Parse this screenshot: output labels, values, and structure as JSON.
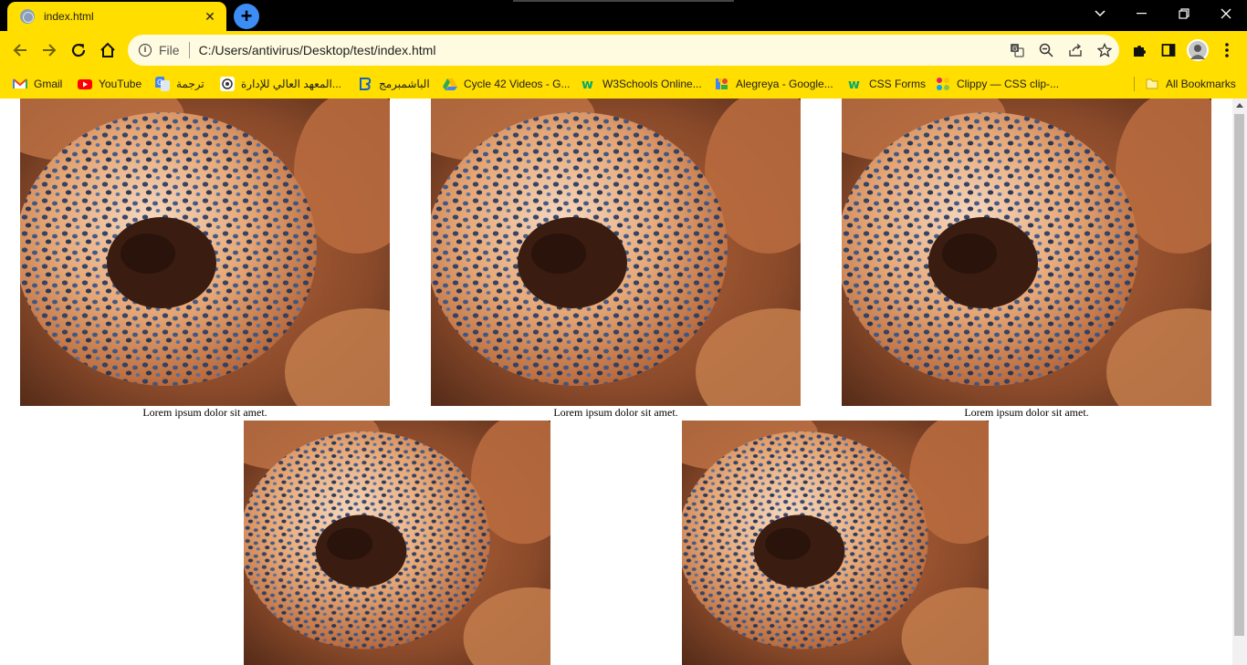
{
  "browser": {
    "tab_title": "index.html",
    "tab_close": "✕",
    "new_tab": "+",
    "window_controls": {
      "minimize": "—",
      "restore": "❐",
      "close": "✕"
    },
    "address": {
      "scheme": "File",
      "url": "C:/Users/antivirus/Desktop/test/index.html"
    },
    "accent_color": "#ffde00"
  },
  "bookmarks": [
    {
      "label": "Gmail",
      "icon": "gmail-icon"
    },
    {
      "label": "YouTube",
      "icon": "youtube-icon"
    },
    {
      "label": "ترجمة",
      "icon": "translate-icon"
    },
    {
      "label": "المعهد العالي للإدارة...",
      "icon": "institute-icon"
    },
    {
      "label": "الباشمبرمج",
      "icon": "bashmohandes-icon"
    },
    {
      "label": "Cycle 42 Videos - G...",
      "icon": "drive-icon"
    },
    {
      "label": "W3Schools Online...",
      "icon": "w3schools-icon"
    },
    {
      "label": "Alegreya - Google...",
      "icon": "google-fonts-icon"
    },
    {
      "label": "CSS Forms",
      "icon": "w3schools-icon"
    },
    {
      "label": "Clippy — CSS clip-...",
      "icon": "clippy-icon"
    }
  ],
  "all_bookmarks": "All Bookmarks",
  "page": {
    "cards": [
      {
        "caption": "Lorem ipsum dolor sit amet.",
        "image": "bagel-photo"
      },
      {
        "caption": "Lorem ipsum dolor sit amet.",
        "image": "bagel-photo"
      },
      {
        "caption": "Lorem ipsum dolor sit amet.",
        "image": "bagel-photo"
      },
      {
        "caption": "",
        "image": "bagel-photo"
      },
      {
        "caption": "",
        "image": "bagel-photo"
      }
    ]
  }
}
